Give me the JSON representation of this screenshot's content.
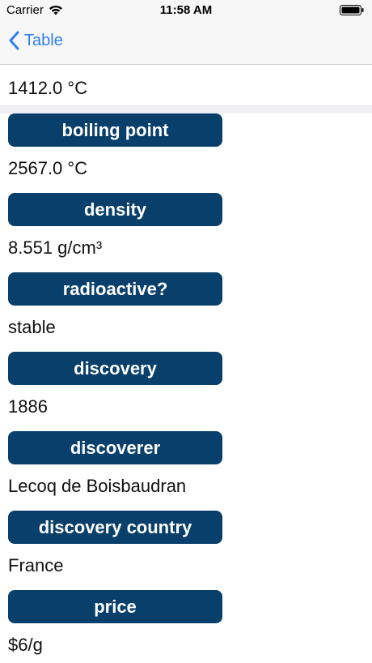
{
  "status_bar": {
    "carrier": "Carrier",
    "time": "11:58 AM"
  },
  "nav": {
    "back_label": "Table"
  },
  "partial_top_value": "1412.0 °C",
  "properties": [
    {
      "label": "boiling point",
      "value": "2567.0 °C"
    },
    {
      "label": "density",
      "value": "8.551 g/cm³"
    },
    {
      "label": "radioactive?",
      "value": "stable"
    },
    {
      "label": "discovery",
      "value": "1886"
    },
    {
      "label": "discoverer",
      "value": "Lecoq de Boisbaudran"
    },
    {
      "label": "discovery country",
      "value": "France"
    },
    {
      "label": "price",
      "value": "$6/g"
    }
  ],
  "colors": {
    "accent": "#2f7ff1",
    "pill": "#083f6b",
    "separator": "#efeff4"
  },
  "icons": [
    "wifi-icon",
    "battery-icon",
    "chevron-left-icon"
  ]
}
